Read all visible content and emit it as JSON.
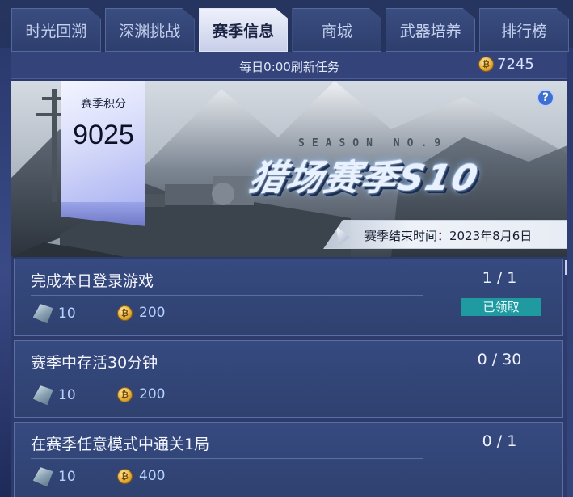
{
  "tabs": [
    {
      "label": "时光回溯",
      "active": false
    },
    {
      "label": "深渊挑战",
      "active": false
    },
    {
      "label": "赛季信息",
      "active": true
    },
    {
      "label": "商城",
      "active": false
    },
    {
      "label": "武器培养",
      "active": false
    },
    {
      "label": "排行榜",
      "active": false
    }
  ],
  "info_bar": {
    "refresh_text": "每日0:00刷新任务",
    "coin_balance": "7245"
  },
  "banner": {
    "score_label": "赛季积分",
    "score_value": "9025",
    "season_en": "SEASON NO.9",
    "season_logo": "猎场赛季S10",
    "end_time_text": "赛季结束时间：2023年8月6日",
    "help_glyph": "?"
  },
  "tasks": [
    {
      "name": "完成本日登录游戏",
      "progress": "1 / 1",
      "gem_reward": "10",
      "coin_reward": "200",
      "status": "已领取"
    },
    {
      "name": "赛季中存活30分钟",
      "progress": "0 / 30",
      "gem_reward": "10",
      "coin_reward": "200",
      "status": ""
    },
    {
      "name": "在赛季任意模式中通关1局",
      "progress": "0 / 1",
      "gem_reward": "10",
      "coin_reward": "400",
      "status": ""
    }
  ],
  "icons": {
    "coin": "coin-icon",
    "gem": "gem-icon",
    "help": "help-icon"
  },
  "colors": {
    "claimed_badge": "#1f9aa0",
    "active_tab": "#eef1fb",
    "panel": "#2c3b6a"
  }
}
